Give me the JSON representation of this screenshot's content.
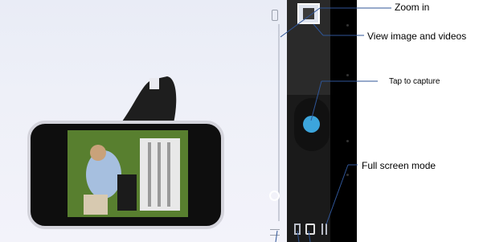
{
  "callouts": {
    "zoom_in": "Zoom in",
    "view_media": "View image and videos",
    "tap_capture": "Tap to capture",
    "full_screen": "Full screen mode"
  },
  "icons": {
    "shutter": "shutter-button",
    "thumbnail": "gallery-thumbnail",
    "zoom": "zoom-slider",
    "modes": [
      "camera-mode-icon",
      "video-mode-icon",
      "panorama-mode-icon"
    ]
  },
  "colors": {
    "shutter": "#3ca5dc",
    "panel": "#000000"
  }
}
